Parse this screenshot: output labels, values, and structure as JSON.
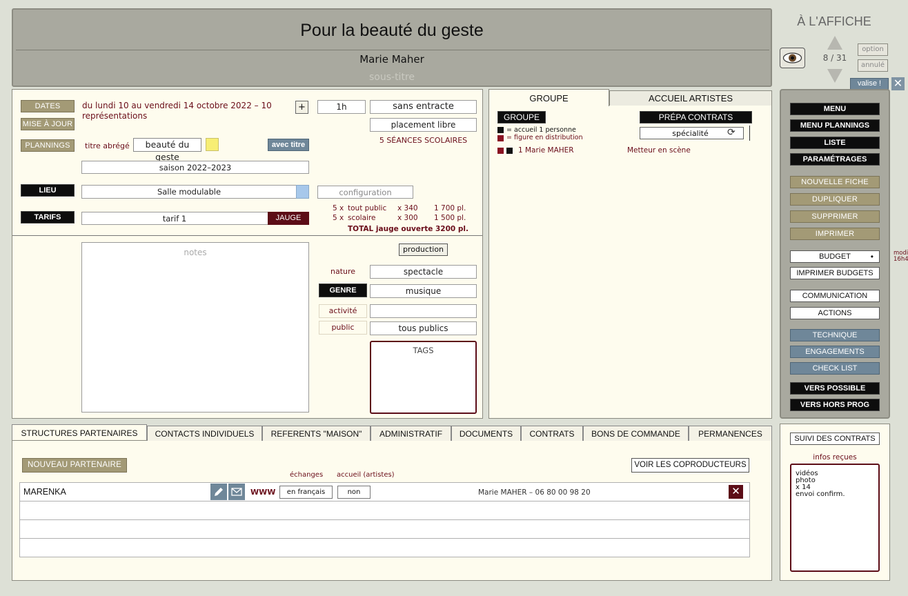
{
  "header": {
    "title": "Pour la beauté du geste",
    "artist": "Marie Maher",
    "subtitle_placeholder": "sous-titre"
  },
  "affiche": {
    "label": "À L'AFFICHE",
    "counter": "8 / 31",
    "option": "option",
    "annule": "annulé",
    "valise": "valise !"
  },
  "dates": {
    "dates_btn": "DATES",
    "mise_a_jour_btn": "MISE À JOUR",
    "plannings_btn": "PLANNINGS",
    "period": "du lundi 10 au vendredi 14 octobre 2022 – 10 représentations",
    "plus": "+",
    "duree": "1h",
    "entracte": "sans entracte",
    "placement": "placement libre",
    "seances_scolaires": "5 SÉANCES SCOLAIRES",
    "titre_abrege_label": "titre abrégé",
    "titre_abrege_value": "beauté du geste",
    "avec_titre": "avec titre",
    "saison": "saison 2022–2023"
  },
  "lieu": {
    "label": "LIEU",
    "value": "Salle modulable",
    "configuration": "configuration"
  },
  "tarifs": {
    "label": "TARIFS",
    "value": "tarif 1",
    "jauge": "JAUGE",
    "rows": [
      {
        "count": "5 x",
        "name": "tout public",
        "mult": "x 340",
        "places": "1 700 pl."
      },
      {
        "count": "5 x",
        "name": "scolaire",
        "mult": "x 300",
        "places": "1 500 pl."
      }
    ],
    "total_label": "TOTAL jauge ouverte",
    "total_value": "3200 pl."
  },
  "details": {
    "notes_placeholder": "notes",
    "production": "production",
    "nature_label": "nature",
    "nature_value": "spectacle",
    "genre_label": "GENRE",
    "genre_value": "musique",
    "activite_label": "activité",
    "activite_value": "",
    "public_label": "public",
    "public_value": "tous publics",
    "tags_label": "TAGS"
  },
  "groupe": {
    "tabs": [
      "GROUPE",
      "ACCUEIL ARTISTES"
    ],
    "groupe_btn": "GROUPE",
    "prepa_btn": "PRÉPA CONTRATS",
    "legend_1": "= accueil 1 personne",
    "legend_2": "= figure en distribution",
    "specialite": "spécialité",
    "members": [
      {
        "num": "1",
        "name": "Marie MAHER",
        "role": "Metteur en scène"
      }
    ]
  },
  "sidebar": {
    "menu": "MENU",
    "menu_plannings": "MENU PLANNINGS",
    "liste": "LISTE",
    "parametrages": "PARAMÉTRAGES",
    "nouvelle_fiche": "NOUVELLE FICHE",
    "dupliquer": "DUPLIQUER",
    "supprimer": "SUPPRIMER",
    "imprimer": "IMPRIMER",
    "budget": "BUDGET",
    "imprimer_budgets": "IMPRIMER BUDGETS",
    "communication": "COMMUNICATION",
    "actions": "ACTIONS",
    "technique": "TECHNIQUE",
    "engagements": "ENGAGEMENTS",
    "check_list": "CHECK LIST",
    "vers_possible": "VERS POSSIBLE",
    "vers_hors_prog": "VERS HORS PROG",
    "modif_1": "modi",
    "modif_2": "16h4"
  },
  "bottom": {
    "tabs": [
      "STRUCTURES PARTENAIRES",
      "CONTACTS INDIVIDUELS",
      "REFERENTS \"MAISON\"",
      "ADMINISTRATIF",
      "DOCUMENTS",
      "CONTRATS",
      "BONS DE COMMANDE",
      "PERMANENCES"
    ],
    "nouveau_partenaire": "NOUVEAU PARTENAIRE",
    "voir_coproducteurs": "VOIR LES COPRODUCTEURS",
    "echanges_label": "échanges",
    "accueil_label": "accueil (artistes)",
    "partner": {
      "name": "MARENKA",
      "www": "WWW",
      "echanges": "en français",
      "accueil": "non",
      "contact": "Marie MAHER – 06 80 00 98 20"
    }
  },
  "suivi": {
    "suivi_btn": "SUIVI DES CONTRATS",
    "infos_label": "infos reçues",
    "infos_lines": [
      "vidéos",
      "photo",
      "x 14",
      "envoi confirm."
    ]
  },
  "colors": {
    "olive": "#a39a76",
    "maroon": "#6a0d1a",
    "steel": "#6f8799",
    "cream": "#fefcee"
  }
}
